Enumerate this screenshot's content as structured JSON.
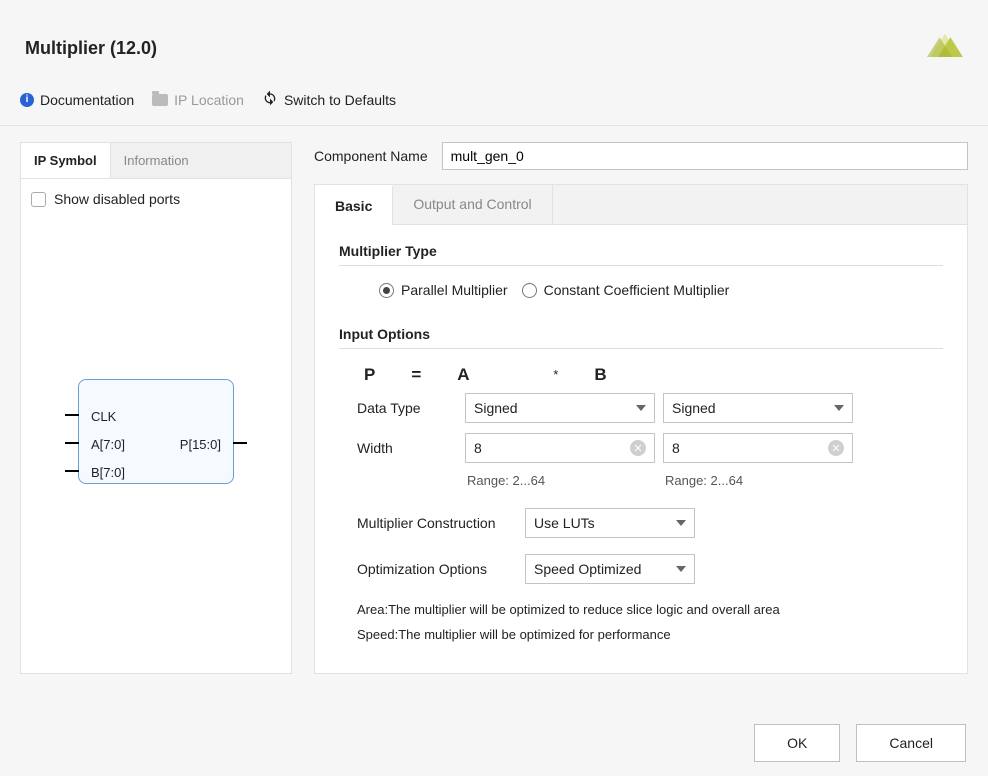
{
  "header": {
    "title": "Multiplier (12.0)"
  },
  "linkbar": {
    "documentation": "Documentation",
    "ip_location": "IP Location",
    "switch_defaults": "Switch to Defaults"
  },
  "left": {
    "tab_symbol": "IP Symbol",
    "tab_info": "Information",
    "show_disabled": "Show disabled ports",
    "ports": {
      "clk": "CLK",
      "a": "A[7:0]",
      "b": "B[7:0]",
      "p": "P[15:0]"
    }
  },
  "component": {
    "label": "Component Name",
    "value": "mult_gen_0"
  },
  "tabs": {
    "basic": "Basic",
    "output": "Output and Control"
  },
  "multtype": {
    "title": "Multiplier Type",
    "parallel": "Parallel Multiplier",
    "constant": "Constant Coefficient Multiplier"
  },
  "inputopts": {
    "title": "Input Options",
    "eq_p": "P",
    "eq_eq": "=",
    "eq_a": "A",
    "eq_star": "*",
    "eq_b": "B",
    "datatype_label": "Data Type",
    "datatype_a": "Signed",
    "datatype_b": "Signed",
    "width_label": "Width",
    "width_a": "8",
    "width_b": "8",
    "range_a": "Range: 2...64",
    "range_b": "Range: 2...64"
  },
  "options": {
    "construction_label": "Multiplier Construction",
    "construction_value": "Use LUTs",
    "optimization_label": "Optimization Options",
    "optimization_value": "Speed Optimized"
  },
  "notes": {
    "area": "Area:The multiplier will be optimized to reduce slice logic and overall area",
    "speed": "Speed:The multiplier will be optimized for performance"
  },
  "footer": {
    "ok": "OK",
    "cancel": "Cancel"
  }
}
